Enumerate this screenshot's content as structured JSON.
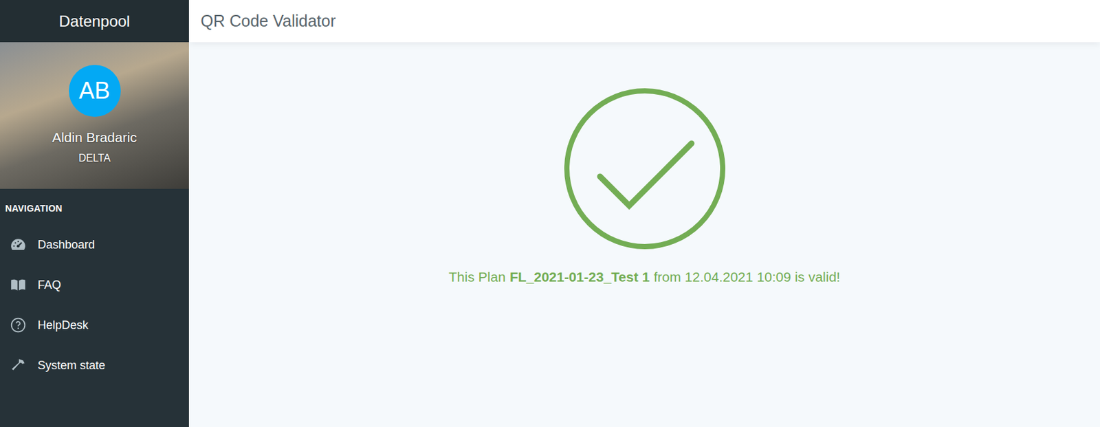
{
  "sidebar": {
    "brand": "Datenpool",
    "user": {
      "initials": "AB",
      "name": "Aldin Bradaric",
      "company": "DELTA"
    },
    "nav_heading": "NAVIGATION",
    "items": [
      {
        "label": "Dashboard",
        "selected": false
      },
      {
        "label": "FAQ",
        "selected": false
      },
      {
        "label": "HelpDesk",
        "selected": false
      },
      {
        "label": "System state",
        "selected": false
      }
    ]
  },
  "header": {
    "title": "QR Code Validator"
  },
  "result": {
    "valid": true,
    "prefix": "This Plan",
    "plan": "FL_2021-01-23_Test 1",
    "suffix": "from 12.04.2021 10:09 is valid!",
    "color": "#73ad54"
  }
}
